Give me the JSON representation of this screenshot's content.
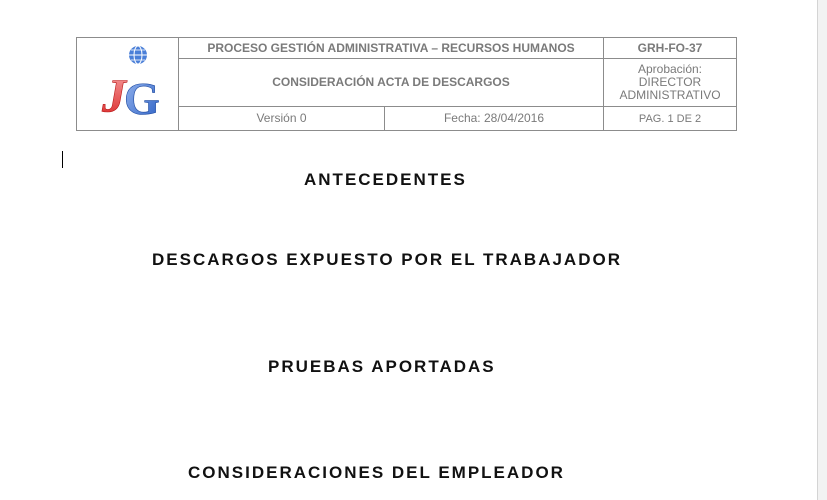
{
  "header": {
    "process": "PROCESO GESTIÓN ADMINISTRATIVA – RECURSOS HUMANOS",
    "code": "GRH-FO-37",
    "form_title": "CONSIDERACIÓN ACTA DE DESCARGOS",
    "approval_label": "Aprobación:",
    "approval_value_1": "DIRECTOR",
    "approval_value_2": "ADMINISTRATIVO",
    "version": "Versión  0",
    "date": "Fecha: 28/04/2016",
    "page": "PAG. 1 DE 2",
    "logo_letters": "JG"
  },
  "sections": [
    "ANTECEDENTES",
    "DESCARGOS EXPUESTO POR EL TRABAJADOR",
    "PRUEBAS APORTADAS",
    "CONSIDERACIONES DEL EMPLEADOR"
  ],
  "colors": {
    "logo_red": "#e03030",
    "logo_blue": "#2a62c8",
    "header_text": "#7a7a7a"
  },
  "icons": {
    "logo": "company-logo-icon",
    "globe": "globe-icon"
  }
}
